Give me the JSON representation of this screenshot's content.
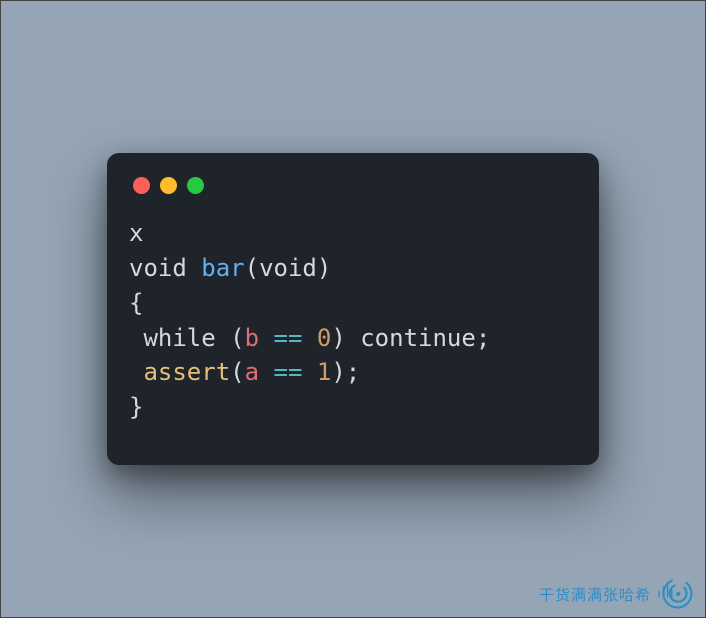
{
  "window": {
    "traffic_lights": [
      "close",
      "minimize",
      "zoom"
    ]
  },
  "code": {
    "line1": "x",
    "line2": {
      "kw_void1": "void",
      "sp1": " ",
      "fn": "bar",
      "lp": "(",
      "kw_void2": "void",
      "rp": ")"
    },
    "line3": "{",
    "line4": {
      "indent": " ",
      "kw_while": "while",
      "sp1": " ",
      "lp": "(",
      "var_b": "b",
      "sp2": " ",
      "op_eq": "==",
      "sp3": " ",
      "num_0": "0",
      "rp": ")",
      "sp4": " ",
      "kw_continue": "continue",
      "semi": ";"
    },
    "line5": {
      "indent": " ",
      "fn_assert": "assert",
      "lp": "(",
      "var_a": "a",
      "sp1": " ",
      "op_eq": "==",
      "sp2": " ",
      "num_1": "1",
      "rp": ")",
      "semi": ";"
    },
    "line6": "}"
  },
  "watermark": {
    "text": "干货满满张哈希"
  }
}
